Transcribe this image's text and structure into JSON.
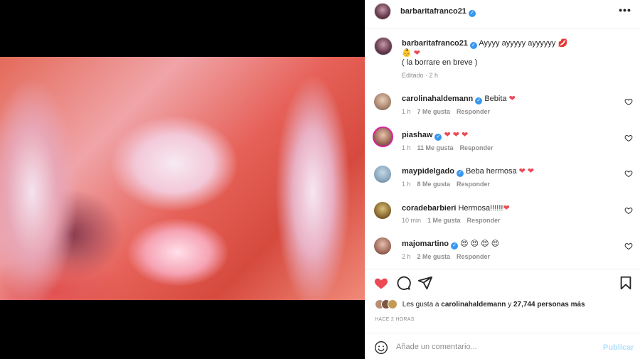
{
  "post": {
    "owner": "barbaritafranco21",
    "more_icon": "more-horizontal-icon"
  },
  "caption": {
    "username": "barbaritafranco21",
    "text": "Ayyyy ayyyyy ayyyyyy",
    "line2_emojis": "👶 ❤",
    "line3": "( la borrare en breve )",
    "edited": "Editado · 2 h"
  },
  "comments": [
    {
      "username": "carolinahaldemann",
      "verified": true,
      "text": "Bebita",
      "emoji": "❤",
      "time": "1 h",
      "likes": "7 Me gusta",
      "reply": "Responder"
    },
    {
      "username": "piashaw",
      "verified": true,
      "text": "",
      "emoji": "❤ ❤ ❤",
      "time": "1 h",
      "likes": "11 Me gusta",
      "reply": "Responder"
    },
    {
      "username": "maypidelgado",
      "verified": true,
      "text": "Beba hermosa",
      "emoji": "❤ ❤",
      "time": "1 h",
      "likes": "8 Me gusta",
      "reply": "Responder"
    },
    {
      "username": "coradebarbieri",
      "verified": false,
      "text": "Hermosa!!!!!!",
      "emoji": "❤",
      "time": "10 min",
      "likes": "1 Me gusta",
      "reply": "Responder"
    },
    {
      "username": "majomartino",
      "verified": true,
      "text": "",
      "emoji": "😍 😍 😍 😍",
      "time": "2 h",
      "likes": "2 Me gusta",
      "reply": "Responder"
    }
  ],
  "likes": {
    "prefix": "Les gusta a",
    "user": "carolinahaldemann",
    "connector": "y",
    "count": "27,744 personas más"
  },
  "timestamp": "HACE 2 HORAS",
  "comment_box": {
    "placeholder": "Añade un comentario...",
    "publish": "Publicar"
  },
  "colors": {
    "accent": "#3897f0",
    "like_red": "#ed4956",
    "publish_disabled": "#b2dffc"
  }
}
